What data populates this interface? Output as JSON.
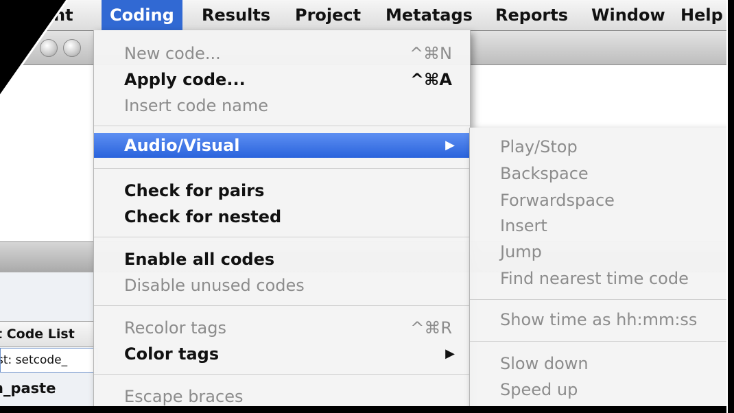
{
  "menubar": {
    "items": [
      {
        "label": "nt"
      },
      {
        "label": "Coding"
      },
      {
        "label": "Results"
      },
      {
        "label": "Project"
      },
      {
        "label": "Metatags"
      },
      {
        "label": "Reports"
      },
      {
        "label": "Window"
      },
      {
        "label": "Help"
      }
    ],
    "active": "Coding"
  },
  "coding_menu": {
    "items": [
      {
        "label": "New code...",
        "shortcut": "^⌘N",
        "enabled": false
      },
      {
        "label": "Apply code...",
        "shortcut": "^⌘A",
        "enabled": true
      },
      {
        "label": "Insert code name",
        "enabled": false
      },
      {
        "label": "Audio/Visual",
        "submenu": true,
        "highlighted": true
      },
      {
        "label": "Check for pairs",
        "enabled": true
      },
      {
        "label": "Check for nested",
        "enabled": true
      },
      {
        "label": "Enable all codes",
        "enabled": true
      },
      {
        "label": "Disable unused codes",
        "enabled": false
      },
      {
        "label": "Recolor tags",
        "shortcut": "^⌘R",
        "enabled": false
      },
      {
        "label": "Color tags",
        "submenu": true,
        "enabled": true
      },
      {
        "label": "Escape braces",
        "enabled": false
      }
    ]
  },
  "av_submenu": {
    "items": [
      {
        "label": "Play/Stop"
      },
      {
        "label": "Backspace"
      },
      {
        "label": "Forwardspace"
      },
      {
        "label": "Insert"
      },
      {
        "label": "Jump"
      },
      {
        "label": "Find nearest time code"
      },
      {
        "label": "Show time as hh:mm:ss"
      },
      {
        "label": "Slow down"
      },
      {
        "label": "Speed up"
      }
    ]
  },
  "background_window": {
    "code_list_header": "t Code List",
    "code_list_input": "st: setcode_",
    "code_list_item": "h_paste"
  },
  "icons": {
    "submenu_arrow": "▶"
  },
  "colors": {
    "highlight": "#3169d3",
    "disabled_text": "#8c8c8c",
    "enabled_text": "#111111"
  }
}
